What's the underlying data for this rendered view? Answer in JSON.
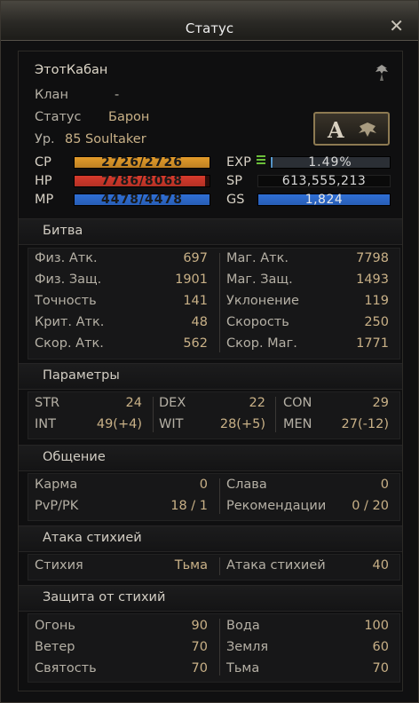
{
  "window": {
    "title": "Статус"
  },
  "character": {
    "name": "ЭтотКабан",
    "clan_label": "Клан",
    "clan_value": "-",
    "status_label": "Статус",
    "status_value": "Барон",
    "level_label": "Ур.",
    "level_value": "85 Soultaker"
  },
  "bars": {
    "cp": {
      "label": "CP",
      "text": "2726/2726",
      "fill": 1.0,
      "color": "#e39b2a"
    },
    "hp": {
      "label": "HP",
      "text": "7786/8068",
      "fill": 0.965,
      "color": "#d63a2c"
    },
    "mp": {
      "label": "MP",
      "text": "4478/4478",
      "fill": 1.0,
      "color": "#2f6fd6"
    },
    "exp": {
      "label": "EXP",
      "text": "1.49%",
      "fill": 0.0149,
      "color": "#5aa0d8"
    },
    "sp": {
      "label": "SP",
      "text": "613,555,213"
    },
    "gs": {
      "label": "GS",
      "text": "1,824",
      "fill": 1.0,
      "color": "#2f6fd6"
    }
  },
  "battle": {
    "title": "Битва",
    "left": [
      {
        "label": "Физ. Атк.",
        "value": "697"
      },
      {
        "label": "Физ. Защ.",
        "value": "1901"
      },
      {
        "label": "Точность",
        "value": "141"
      },
      {
        "label": "Крит. Атк.",
        "value": "48"
      },
      {
        "label": "Скор. Атк.",
        "value": "562"
      }
    ],
    "right": [
      {
        "label": "Маг. Атк.",
        "value": "7798"
      },
      {
        "label": "Маг. Защ.",
        "value": "1493"
      },
      {
        "label": "Уклонение",
        "value": "119"
      },
      {
        "label": "Скорость",
        "value": "250"
      },
      {
        "label": "Скор. Маг.",
        "value": "1771"
      }
    ]
  },
  "params": {
    "title": "Параметры",
    "items": [
      {
        "label": "STR",
        "value": "24"
      },
      {
        "label": "DEX",
        "value": "22"
      },
      {
        "label": "CON",
        "value": "29"
      },
      {
        "label": "INT",
        "value": "49(+4)"
      },
      {
        "label": "WIT",
        "value": "28(+5)"
      },
      {
        "label": "MEN",
        "value": "27(-12)"
      }
    ]
  },
  "social": {
    "title": "Общение",
    "left": [
      {
        "label": "Карма",
        "value": "0"
      },
      {
        "label": "PvP/PK",
        "value": "18 / 1"
      }
    ],
    "right": [
      {
        "label": "Слава",
        "value": "0"
      },
      {
        "label": "Рекомендации",
        "value": "0 / 20"
      }
    ]
  },
  "attack_element": {
    "title": "Атака стихией",
    "left": {
      "label": "Стихия",
      "value": "Тьма"
    },
    "right": {
      "label": "Атака стихией",
      "value": "40"
    }
  },
  "defense_element": {
    "title": "Защита от стихий",
    "left": [
      {
        "label": "Огонь",
        "value": "90"
      },
      {
        "label": "Ветер",
        "value": "70"
      },
      {
        "label": "Святость",
        "value": "70"
      }
    ],
    "right": [
      {
        "label": "Вода",
        "value": "100"
      },
      {
        "label": "Земля",
        "value": "60"
      },
      {
        "label": "Тьма",
        "value": "70"
      }
    ]
  },
  "icons": {
    "close": "close-icon",
    "clan_emblem": "clan-emblem-icon",
    "rank_button": "rank-a-icon"
  }
}
